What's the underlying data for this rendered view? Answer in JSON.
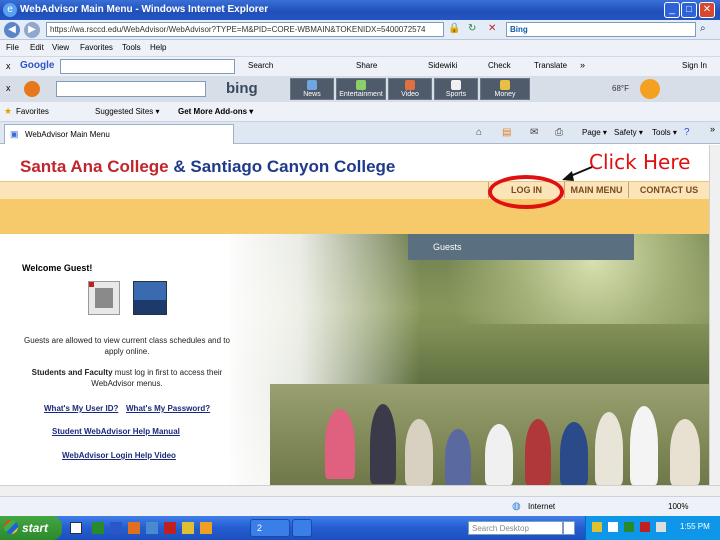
{
  "window": {
    "title": "WebAdvisor Main Menu - Windows Internet Explorer",
    "address": "https://wa.rsccd.edu/WebAdvisor/WebAdvisor?TYPE=M&PID=CORE-WBMAIN&TOKENIDX=5400072574",
    "search_engine": "Bing"
  },
  "menu": {
    "file": "File",
    "edit": "Edit",
    "view": "View",
    "favorites": "Favorites",
    "tools": "Tools",
    "help": "Help"
  },
  "google_toolbar": {
    "close": "x",
    "logo": "Google",
    "search": "Search",
    "share": "Share",
    "sidewiki": "Sidewiki",
    "check": "Check",
    "translate": "Translate",
    "more": "»",
    "signin": "Sign In"
  },
  "bing_toolbar": {
    "close": "x",
    "logo": "bing",
    "buttons": [
      "News",
      "Entertainment",
      "Video",
      "Sports",
      "Money"
    ],
    "temp": "68°F"
  },
  "favorites_bar": {
    "favorites": "Favorites",
    "suggested": "Suggested Sites ▾",
    "addons": "Get More Add-ons ▾"
  },
  "tab": {
    "label": "WebAdvisor Main Menu"
  },
  "command_bar": {
    "page": "Page ▾",
    "safety": "Safety ▾",
    "tools": "Tools ▾",
    "more": "»"
  },
  "page": {
    "title_part1": "Santa Ana College",
    "title_amp": "&",
    "title_part2": "Santiago Canyon College",
    "nav": {
      "login": "LOG IN",
      "main_menu": "MAIN MENU",
      "contact": "CONTACT US"
    },
    "guests_header": "Guests",
    "welcome": "Welcome Guest!",
    "guests_text": "Guests are allowed to view current class schedules and to apply online.",
    "students_bold": "Students and Faculty",
    "students_text": " must log in first to access their WebAdvisor menus.",
    "link_user_id": "What's My User ID?",
    "link_password": "What's My Password?",
    "link_manual": "Student WebAdvisor Help Manual",
    "link_video": "WebAdvisor Login Help Video"
  },
  "annotation": {
    "click_here": "Click Here"
  },
  "status": {
    "zone": "Internet",
    "zoom": "100%"
  },
  "taskbar": {
    "start": "start",
    "ie_group": "2",
    "search": "Search Desktop",
    "clock": "1:55 PM"
  },
  "colors": {
    "title_blue": "#1f3a8a",
    "title_red": "#c0262c",
    "nav_bar": "#f2d29a",
    "banner": "#f6c96b",
    "guests_header": "#5a7080",
    "annotation_red": "#e01010"
  }
}
